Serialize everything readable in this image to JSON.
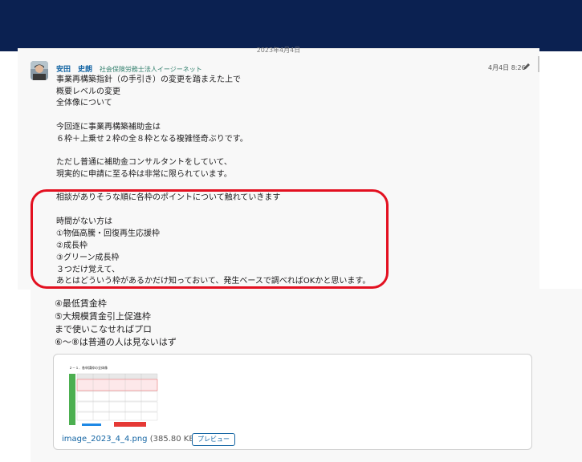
{
  "date_divider": "2023年4月4日",
  "message": {
    "sender_name": "安田　史朗",
    "sender_org": "社会保険労務士法人イージーネット",
    "timestamp": "4月4日 8:26",
    "lines": [
      "事業再構築指針（の手引き）の変更を踏まえた上で",
      "概要レベルの変更",
      "全体像について",
      "",
      "今回逐に事業再構築補助金は",
      "６枠＋上乗せ２枠の全８枠となる複雑怪奇ぶりです。",
      "",
      "ただし普通に補助金コンサルタントをしていて、",
      "現実的に申請に至る枠は非常に限られています。",
      "",
      "相談がありそうな順に各枠のポイントについて触れていきます",
      "",
      "時間がない方は",
      "①物価高騰・回復再生応援枠",
      "②成長枠",
      "③グリーン成長枠",
      "３つだけ覚えて、",
      "あとはどういう枠があるかだけ知っておいて、発生ベースで調べればOKかと思います。"
    ],
    "continued_lines": [
      "④最低賃金枠",
      "⑤大規模賃金引上促進枠",
      "まで使いこなせればプロ",
      "⑥～⑧は普通の人は見ないはず"
    ]
  },
  "attachment": {
    "file_name": "image_2023_4_4.png",
    "file_size": "(385.80 KB)",
    "preview_label": "プレビュー",
    "thumbnail_title": "２－１．各申請枠の全体像"
  },
  "colors": {
    "header_bg": "#0b2151",
    "highlight_border": "#e31020",
    "link": "#1264a3"
  }
}
